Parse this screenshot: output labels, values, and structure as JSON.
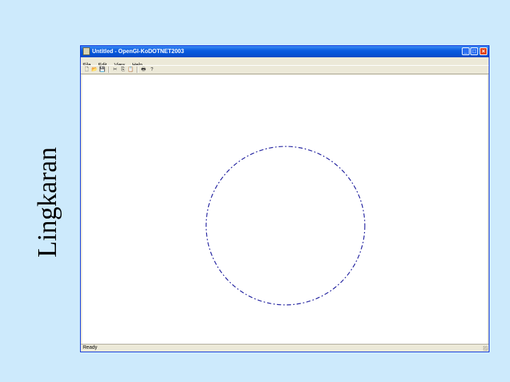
{
  "slide": {
    "title": "Lingkaran"
  },
  "window": {
    "title": "Untitled - OpenGl-KoDOTNET2003",
    "caption_buttons": {
      "minimize": "_",
      "maximize": "□",
      "close": "×"
    }
  },
  "menu": {
    "items": [
      "File",
      "Edit",
      "View",
      "Help"
    ]
  },
  "toolbar": {
    "icons": [
      "new-icon",
      "open-icon",
      "save-icon",
      "cut-icon",
      "copy-icon",
      "paste-icon",
      "print-icon",
      "help-icon"
    ],
    "glyphs": {
      "new": "🗋",
      "open": "📂",
      "save": "💾",
      "cut": "✂",
      "copy": "⎘",
      "paste": "📋",
      "print": "🖶",
      "help": "?"
    }
  },
  "canvas": {
    "shape": "circle",
    "stroke_color": "#1a1a9c",
    "style": "dashed"
  },
  "statusbar": {
    "text": "Ready"
  }
}
